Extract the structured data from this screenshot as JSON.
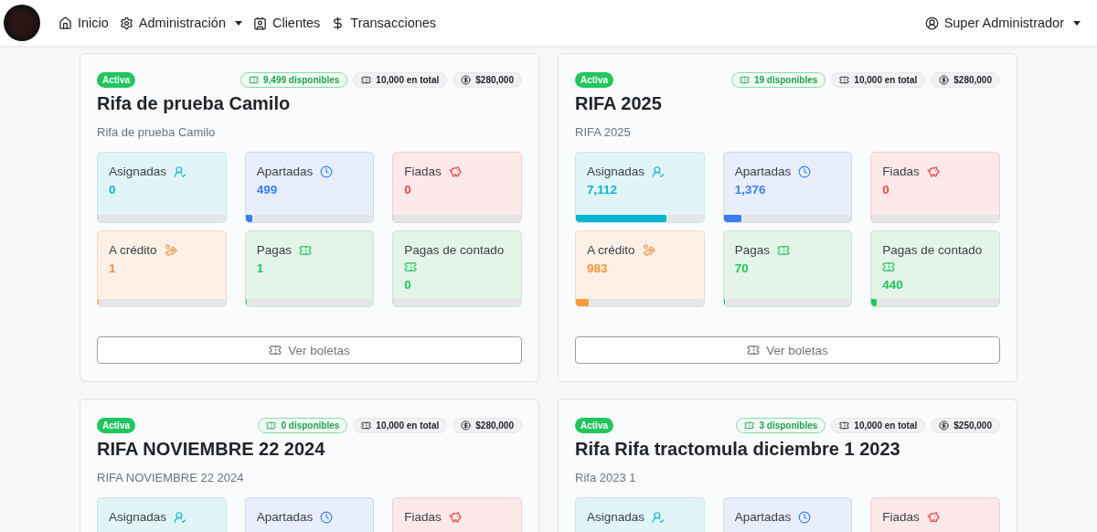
{
  "navbar": {
    "items": [
      {
        "kind": "home",
        "label": "Inicio",
        "dropdown": false
      },
      {
        "kind": "settings",
        "label": "Administración",
        "dropdown": true
      },
      {
        "kind": "clients",
        "label": "Clientes",
        "dropdown": false
      },
      {
        "kind": "money",
        "label": "Transacciones",
        "dropdown": false
      }
    ],
    "user": {
      "label": "Super Administrador",
      "dropdown": true
    }
  },
  "raffles": [
    {
      "status": "Activa",
      "available": "9,499 disponibles",
      "total": "10,000 en total",
      "price": "$280,000",
      "title": "Rifa de prueba Camilo",
      "description": "Rifa de prueba Camilo",
      "button": "Ver boletas",
      "stats": [
        {
          "kind": "assigned",
          "label": "Asignadas",
          "value": "0",
          "level": 0
        },
        {
          "kind": "reserved",
          "label": "Apartadas",
          "value": "499",
          "level": 0.05
        },
        {
          "kind": "trusted",
          "label": "Fiadas",
          "value": "0",
          "level": 0
        },
        {
          "kind": "credit",
          "label": "A crédito",
          "value": "1",
          "level": 0.001
        },
        {
          "kind": "paid",
          "label": "Pagas",
          "value": "1",
          "level": 0.001
        },
        {
          "kind": "cash",
          "label": "Pagas de contado",
          "value": "0",
          "level": 0
        }
      ]
    },
    {
      "status": "Activa",
      "available": "19 disponibles",
      "total": "10,000 en total",
      "price": "$280,000",
      "title": "RIFA 2025",
      "description": "RIFA 2025",
      "button": "Ver boletas",
      "stats": [
        {
          "kind": "assigned",
          "label": "Asignadas",
          "value": "7,112",
          "level": 0.711
        },
        {
          "kind": "reserved",
          "label": "Apartadas",
          "value": "1,376",
          "level": 0.138
        },
        {
          "kind": "trusted",
          "label": "Fiadas",
          "value": "0",
          "level": 0
        },
        {
          "kind": "credit",
          "label": "A crédito",
          "value": "983",
          "level": 0.098
        },
        {
          "kind": "paid",
          "label": "Pagas",
          "value": "70",
          "level": 0.007
        },
        {
          "kind": "cash",
          "label": "Pagas de contado",
          "value": "440",
          "level": 0.044
        }
      ]
    },
    {
      "status": "Activa",
      "available": "0 disponibles",
      "total": "10,000 en total",
      "price": "$280,000",
      "title": "RIFA NOVIEMBRE 22 2024",
      "description": "RIFA NOVIEMBRE 22 2024",
      "stats": [
        {
          "kind": "assigned",
          "label": "Asignadas"
        },
        {
          "kind": "reserved",
          "label": "Apartadas"
        },
        {
          "kind": "trusted",
          "label": "Fiadas"
        }
      ]
    },
    {
      "status": "Activa",
      "available": "3 disponibles",
      "total": "10,000 en total",
      "price": "$250,000",
      "title": "Rifa Rifa tractomula diciembre 1 2023",
      "description": "Rifa 2023 1",
      "stats": [
        {
          "kind": "assigned",
          "label": "Asignadas"
        },
        {
          "kind": "reserved",
          "label": "Apartadas"
        },
        {
          "kind": "trusted",
          "label": "Fiadas"
        }
      ]
    }
  ]
}
